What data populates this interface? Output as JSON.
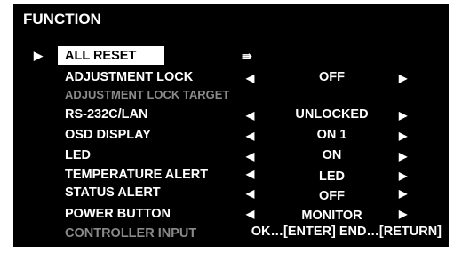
{
  "colors": {
    "panel_bg": "#000000",
    "text": "#ffffff",
    "disabled": "#8a8a8a",
    "selection_bg": "#ffffff",
    "selection_text": "#000000"
  },
  "menu": {
    "title": "FUNCTION",
    "cursor_icon": "triangle-right-icon",
    "cursor_glyph": "▶",
    "left_arrow_glyph": "◀",
    "right_arrow_glyph": "▶",
    "enter_glyph": "⇛",
    "items": [
      {
        "label": "ALL RESET",
        "selected": true,
        "action": "enter"
      },
      {
        "label": "ADJUSTMENT LOCK",
        "value": "OFF"
      },
      {
        "label": "ADJUSTMENT LOCK TARGET",
        "disabled": true
      },
      {
        "label": "RS-232C/LAN",
        "value": "UNLOCKED"
      },
      {
        "label": "OSD DISPLAY",
        "value": "ON 1"
      },
      {
        "label": "LED",
        "value": "ON"
      },
      {
        "label": "TEMPERATURE ALERT",
        "value": "LED"
      },
      {
        "label": "STATUS ALERT",
        "value": "OFF"
      },
      {
        "label": "POWER BUTTON",
        "value": "MONITOR"
      },
      {
        "label": "CONTROLLER INPUT",
        "disabled": true
      }
    ]
  },
  "footer": {
    "hint": "OK…[ENTER]  END…[RETURN]"
  }
}
